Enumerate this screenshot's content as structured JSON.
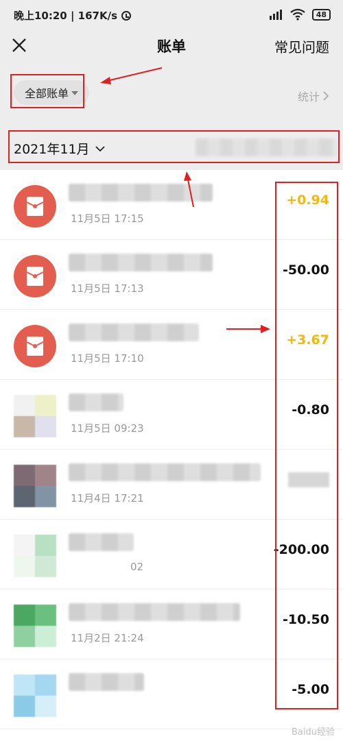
{
  "status_bar": {
    "time_speed": "晚上10:20 | 167K/s",
    "battery": "48"
  },
  "header": {
    "title": "账单",
    "faq": "常见问题"
  },
  "filter": {
    "label": "全部账单",
    "stats": "统计"
  },
  "month": {
    "label": "2021年11月"
  },
  "bills": [
    {
      "time": "11月5日 17:15",
      "amount": "+0.94",
      "kind": "income",
      "icon": "red-packet-icon"
    },
    {
      "time": "11月5日 17:13",
      "amount": "-50.00",
      "kind": "expense",
      "icon": "red-packet-icon"
    },
    {
      "time": "11月5日 17:10",
      "amount": "+3.67",
      "kind": "income",
      "icon": "red-packet-icon"
    },
    {
      "time": "11月5日 09:23",
      "amount": "-0.80",
      "kind": "expense",
      "icon": "avatar-icon"
    },
    {
      "time": "11月4日 17:21",
      "amount": "",
      "kind": "expense",
      "icon": "avatar-icon"
    },
    {
      "time": "02",
      "amount": "-200.00",
      "kind": "expense",
      "icon": "avatar-icon"
    },
    {
      "time": "11月2日 21:24",
      "amount": "-10.50",
      "kind": "expense",
      "icon": "avatar-icon"
    },
    {
      "time": "",
      "amount": "-5.00",
      "kind": "expense",
      "icon": "avatar-icon"
    }
  ],
  "colors": {
    "income": "#f0b90b",
    "red_packet": "#e35e4f",
    "annotation": "#e02020"
  },
  "watermark": "Baidu经验"
}
